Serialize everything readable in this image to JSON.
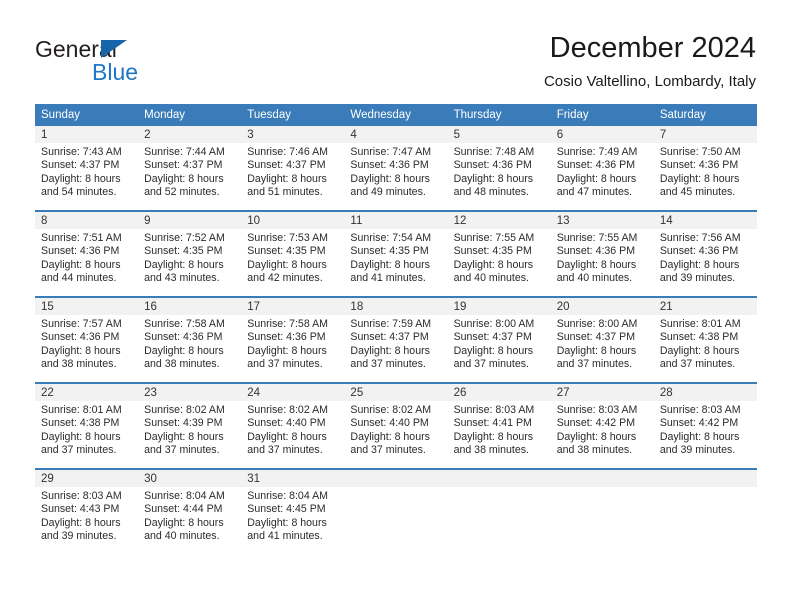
{
  "brand": {
    "name_top": "General",
    "name_bottom": "Blue",
    "color_dark": "#231f20",
    "color_blue": "#1f76c4",
    "triangle_color": "#1565ab"
  },
  "header": {
    "title": "December 2024",
    "subtitle": "Cosio Valtellino, Lombardy, Italy"
  },
  "theme": {
    "header_bg": "#3a7cb9",
    "header_text": "#ffffff",
    "daynum_bg": "#f2f2f2",
    "cell_text": "#2b2b2b",
    "row_divider": "#3a7cb9"
  },
  "weekdays": [
    "Sunday",
    "Monday",
    "Tuesday",
    "Wednesday",
    "Thursday",
    "Friday",
    "Saturday"
  ],
  "weeks": [
    [
      {
        "day": "1",
        "sunrise": "Sunrise: 7:43 AM",
        "sunset": "Sunset: 4:37 PM",
        "daylight1": "Daylight: 8 hours",
        "daylight2": "and 54 minutes."
      },
      {
        "day": "2",
        "sunrise": "Sunrise: 7:44 AM",
        "sunset": "Sunset: 4:37 PM",
        "daylight1": "Daylight: 8 hours",
        "daylight2": "and 52 minutes."
      },
      {
        "day": "3",
        "sunrise": "Sunrise: 7:46 AM",
        "sunset": "Sunset: 4:37 PM",
        "daylight1": "Daylight: 8 hours",
        "daylight2": "and 51 minutes."
      },
      {
        "day": "4",
        "sunrise": "Sunrise: 7:47 AM",
        "sunset": "Sunset: 4:36 PM",
        "daylight1": "Daylight: 8 hours",
        "daylight2": "and 49 minutes."
      },
      {
        "day": "5",
        "sunrise": "Sunrise: 7:48 AM",
        "sunset": "Sunset: 4:36 PM",
        "daylight1": "Daylight: 8 hours",
        "daylight2": "and 48 minutes."
      },
      {
        "day": "6",
        "sunrise": "Sunrise: 7:49 AM",
        "sunset": "Sunset: 4:36 PM",
        "daylight1": "Daylight: 8 hours",
        "daylight2": "and 47 minutes."
      },
      {
        "day": "7",
        "sunrise": "Sunrise: 7:50 AM",
        "sunset": "Sunset: 4:36 PM",
        "daylight1": "Daylight: 8 hours",
        "daylight2": "and 45 minutes."
      }
    ],
    [
      {
        "day": "8",
        "sunrise": "Sunrise: 7:51 AM",
        "sunset": "Sunset: 4:36 PM",
        "daylight1": "Daylight: 8 hours",
        "daylight2": "and 44 minutes."
      },
      {
        "day": "9",
        "sunrise": "Sunrise: 7:52 AM",
        "sunset": "Sunset: 4:35 PM",
        "daylight1": "Daylight: 8 hours",
        "daylight2": "and 43 minutes."
      },
      {
        "day": "10",
        "sunrise": "Sunrise: 7:53 AM",
        "sunset": "Sunset: 4:35 PM",
        "daylight1": "Daylight: 8 hours",
        "daylight2": "and 42 minutes."
      },
      {
        "day": "11",
        "sunrise": "Sunrise: 7:54 AM",
        "sunset": "Sunset: 4:35 PM",
        "daylight1": "Daylight: 8 hours",
        "daylight2": "and 41 minutes."
      },
      {
        "day": "12",
        "sunrise": "Sunrise: 7:55 AM",
        "sunset": "Sunset: 4:35 PM",
        "daylight1": "Daylight: 8 hours",
        "daylight2": "and 40 minutes."
      },
      {
        "day": "13",
        "sunrise": "Sunrise: 7:55 AM",
        "sunset": "Sunset: 4:36 PM",
        "daylight1": "Daylight: 8 hours",
        "daylight2": "and 40 minutes."
      },
      {
        "day": "14",
        "sunrise": "Sunrise: 7:56 AM",
        "sunset": "Sunset: 4:36 PM",
        "daylight1": "Daylight: 8 hours",
        "daylight2": "and 39 minutes."
      }
    ],
    [
      {
        "day": "15",
        "sunrise": "Sunrise: 7:57 AM",
        "sunset": "Sunset: 4:36 PM",
        "daylight1": "Daylight: 8 hours",
        "daylight2": "and 38 minutes."
      },
      {
        "day": "16",
        "sunrise": "Sunrise: 7:58 AM",
        "sunset": "Sunset: 4:36 PM",
        "daylight1": "Daylight: 8 hours",
        "daylight2": "and 38 minutes."
      },
      {
        "day": "17",
        "sunrise": "Sunrise: 7:58 AM",
        "sunset": "Sunset: 4:36 PM",
        "daylight1": "Daylight: 8 hours",
        "daylight2": "and 37 minutes."
      },
      {
        "day": "18",
        "sunrise": "Sunrise: 7:59 AM",
        "sunset": "Sunset: 4:37 PM",
        "daylight1": "Daylight: 8 hours",
        "daylight2": "and 37 minutes."
      },
      {
        "day": "19",
        "sunrise": "Sunrise: 8:00 AM",
        "sunset": "Sunset: 4:37 PM",
        "daylight1": "Daylight: 8 hours",
        "daylight2": "and 37 minutes."
      },
      {
        "day": "20",
        "sunrise": "Sunrise: 8:00 AM",
        "sunset": "Sunset: 4:37 PM",
        "daylight1": "Daylight: 8 hours",
        "daylight2": "and 37 minutes."
      },
      {
        "day": "21",
        "sunrise": "Sunrise: 8:01 AM",
        "sunset": "Sunset: 4:38 PM",
        "daylight1": "Daylight: 8 hours",
        "daylight2": "and 37 minutes."
      }
    ],
    [
      {
        "day": "22",
        "sunrise": "Sunrise: 8:01 AM",
        "sunset": "Sunset: 4:38 PM",
        "daylight1": "Daylight: 8 hours",
        "daylight2": "and 37 minutes."
      },
      {
        "day": "23",
        "sunrise": "Sunrise: 8:02 AM",
        "sunset": "Sunset: 4:39 PM",
        "daylight1": "Daylight: 8 hours",
        "daylight2": "and 37 minutes."
      },
      {
        "day": "24",
        "sunrise": "Sunrise: 8:02 AM",
        "sunset": "Sunset: 4:40 PM",
        "daylight1": "Daylight: 8 hours",
        "daylight2": "and 37 minutes."
      },
      {
        "day": "25",
        "sunrise": "Sunrise: 8:02 AM",
        "sunset": "Sunset: 4:40 PM",
        "daylight1": "Daylight: 8 hours",
        "daylight2": "and 37 minutes."
      },
      {
        "day": "26",
        "sunrise": "Sunrise: 8:03 AM",
        "sunset": "Sunset: 4:41 PM",
        "daylight1": "Daylight: 8 hours",
        "daylight2": "and 38 minutes."
      },
      {
        "day": "27",
        "sunrise": "Sunrise: 8:03 AM",
        "sunset": "Sunset: 4:42 PM",
        "daylight1": "Daylight: 8 hours",
        "daylight2": "and 38 minutes."
      },
      {
        "day": "28",
        "sunrise": "Sunrise: 8:03 AM",
        "sunset": "Sunset: 4:42 PM",
        "daylight1": "Daylight: 8 hours",
        "daylight2": "and 39 minutes."
      }
    ],
    [
      {
        "day": "29",
        "sunrise": "Sunrise: 8:03 AM",
        "sunset": "Sunset: 4:43 PM",
        "daylight1": "Daylight: 8 hours",
        "daylight2": "and 39 minutes."
      },
      {
        "day": "30",
        "sunrise": "Sunrise: 8:04 AM",
        "sunset": "Sunset: 4:44 PM",
        "daylight1": "Daylight: 8 hours",
        "daylight2": "and 40 minutes."
      },
      {
        "day": "31",
        "sunrise": "Sunrise: 8:04 AM",
        "sunset": "Sunset: 4:45 PM",
        "daylight1": "Daylight: 8 hours",
        "daylight2": "and 41 minutes."
      },
      {
        "day": "",
        "sunrise": "",
        "sunset": "",
        "daylight1": "",
        "daylight2": ""
      },
      {
        "day": "",
        "sunrise": "",
        "sunset": "",
        "daylight1": "",
        "daylight2": ""
      },
      {
        "day": "",
        "sunrise": "",
        "sunset": "",
        "daylight1": "",
        "daylight2": ""
      },
      {
        "day": "",
        "sunrise": "",
        "sunset": "",
        "daylight1": "",
        "daylight2": ""
      }
    ]
  ]
}
